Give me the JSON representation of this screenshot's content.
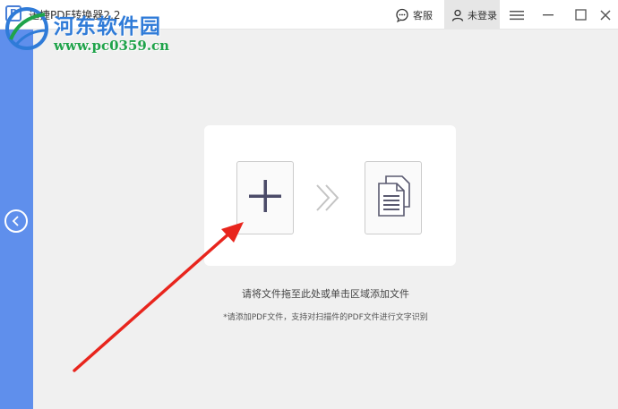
{
  "window": {
    "title": "迅捷PDF转换器2.2",
    "feedback_label": "客服",
    "user_label": "未登录"
  },
  "watermark": {
    "site_name": "河东软件园",
    "site_url": "www.pc0359.cn"
  },
  "main": {
    "drop_hint": "请将文件拖至此处或单击区域添加文件",
    "sub_hint": "*请添加PDF文件，支持对扫描件的PDF文件进行文字识别"
  },
  "colors": {
    "sidebar": "#5f8fec",
    "annotation_arrow": "#e8251d",
    "watermark_blue": "#2f7bd8",
    "watermark_green": "#1fa34a"
  },
  "icons": {
    "feedback": "chat-bubble-icon",
    "user": "user-icon",
    "menu": "hamburger-menu-icon",
    "minimize": "minimize-icon",
    "maximize": "maximize-icon",
    "close": "close-icon",
    "sidebar_toggle": "chevron-left-circle-icon",
    "add_file": "plus-icon",
    "convert": "double-chevron-right-icon",
    "document": "documents-icon"
  }
}
